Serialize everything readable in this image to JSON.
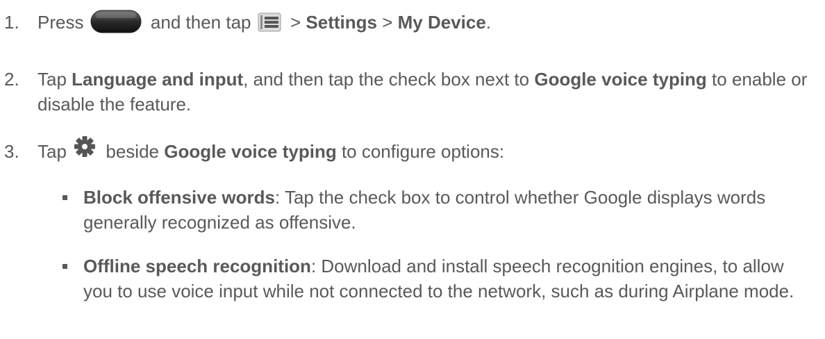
{
  "colors": {
    "text": "#595959",
    "icon": "#555555"
  },
  "icons": [
    "home-key-icon",
    "menu-icon",
    "gear-icon"
  ],
  "steps": [
    {
      "number": "1.",
      "segments": [
        "Press",
        " and then tap",
        " > ",
        "Settings",
        " > ",
        "My Device",
        "."
      ]
    },
    {
      "number": "2.",
      "segments": [
        "Tap ",
        "Language and input",
        ", and then tap the check box next to ",
        "Google voice typing",
        " to enable or disable the feature."
      ]
    },
    {
      "number": "3.",
      "segments": [
        "Tap",
        " beside ",
        "Google voice typing",
        " to configure options:"
      ]
    }
  ],
  "bullets": [
    {
      "term": "Block offensive words",
      "text": ": Tap the check box to control whether Google displays words generally recognized as offensive."
    },
    {
      "term": "Offline speech recognition",
      "text": ": Download and install speech recognition engines, to allow you to use voice input while not connected to the network, such as during Airplane mode."
    }
  ]
}
